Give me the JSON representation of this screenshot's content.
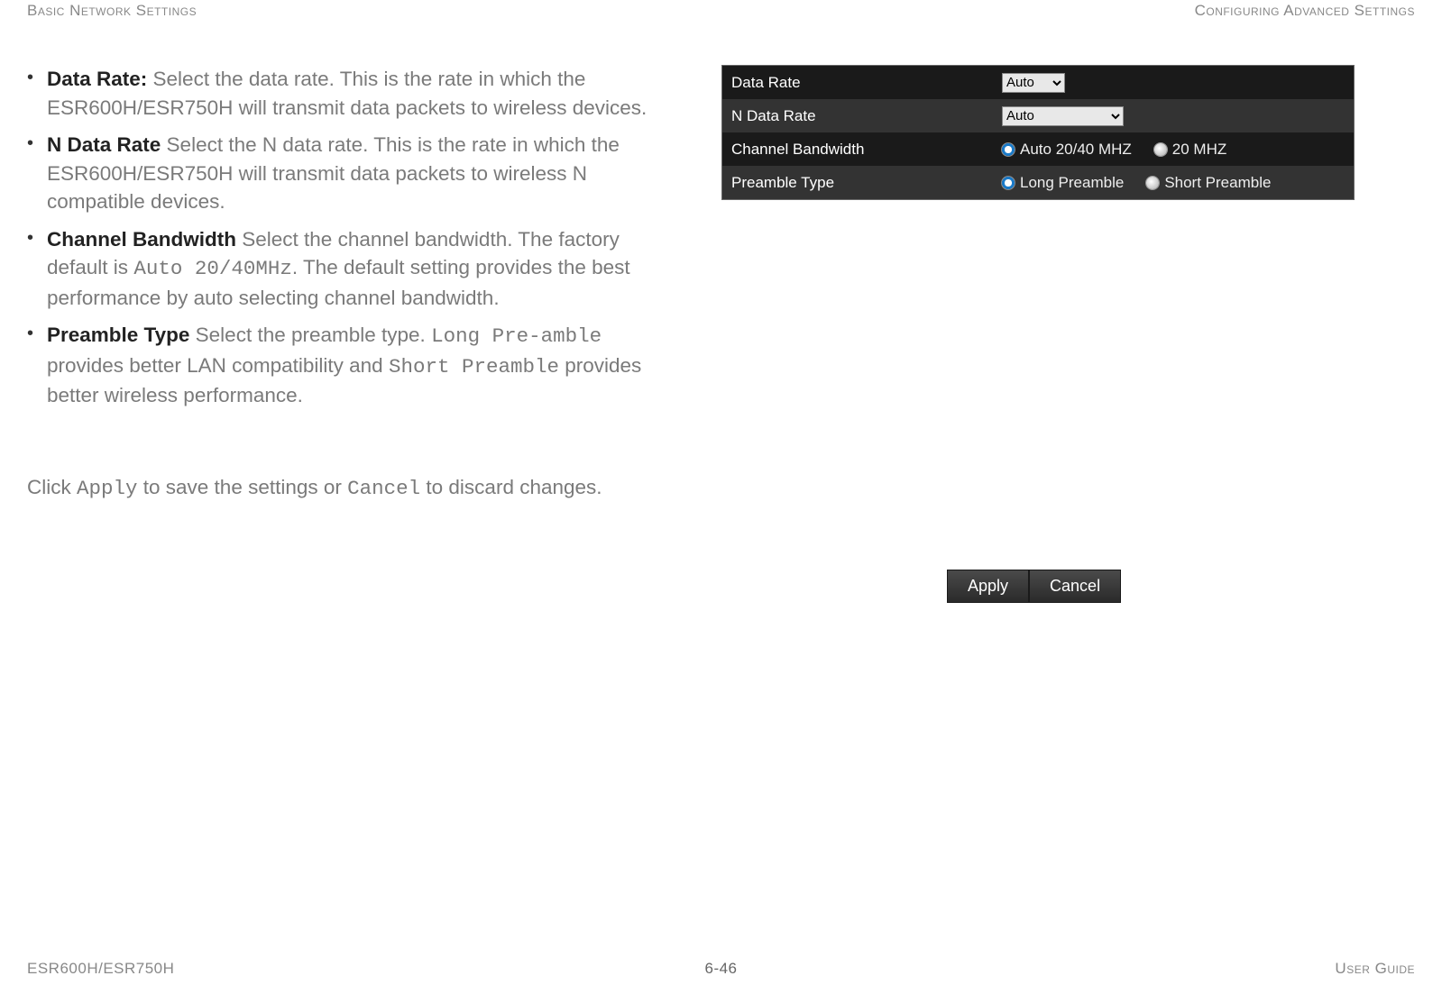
{
  "header": {
    "left": "Basic Network Settings",
    "right": "Configuring Advanced Settings"
  },
  "bullets": {
    "data_rate": {
      "term": "Data Rate:",
      "text": " Select the data rate.  This is the rate in which the ESR600H/ESR750H will transmit data packets to wireless devices."
    },
    "n_data_rate": {
      "term": "N Data Rate",
      "text": "  Select the N data rate. This is the rate in which the ESR600H/ESR750H will transmit data packets to wireless N compatible devices."
    },
    "channel_bw": {
      "term": "Channel Bandwidth",
      "text_a": "  Select the channel bandwidth. The factory default is ",
      "code_a": "Auto 20/40MHz",
      "text_b": ". The default setting provides the best performance by auto selecting channel bandwidth."
    },
    "preamble": {
      "term": "Preamble Type",
      "text_a": "  Select the preamble type. ",
      "code_a": "Long Pre-amble",
      "text_b": " provides better LAN compatibility and ",
      "code_b": "Short Preamble",
      "text_c": " provides better wireless performance."
    }
  },
  "apply_line": {
    "a": "Click ",
    "apply": "Apply",
    "b": " to save the settings or ",
    "cancel": "Cancel",
    "c": " to discard changes."
  },
  "settings": {
    "rows": {
      "data_rate": {
        "label": "Data Rate",
        "value": "Auto"
      },
      "n_data_rate": {
        "label": "N Data Rate",
        "value": "Auto"
      },
      "channel_bw": {
        "label": "Channel Bandwidth",
        "opt1": "Auto 20/40 MHZ",
        "opt2": "20 MHZ"
      },
      "preamble": {
        "label": "Preamble Type",
        "opt1": "Long Preamble",
        "opt2": "Short Preamble"
      }
    }
  },
  "buttons": {
    "apply": "Apply",
    "cancel": "Cancel"
  },
  "footer": {
    "left": "ESR600H/ESR750H",
    "center": "6-46",
    "right": "User Guide"
  }
}
